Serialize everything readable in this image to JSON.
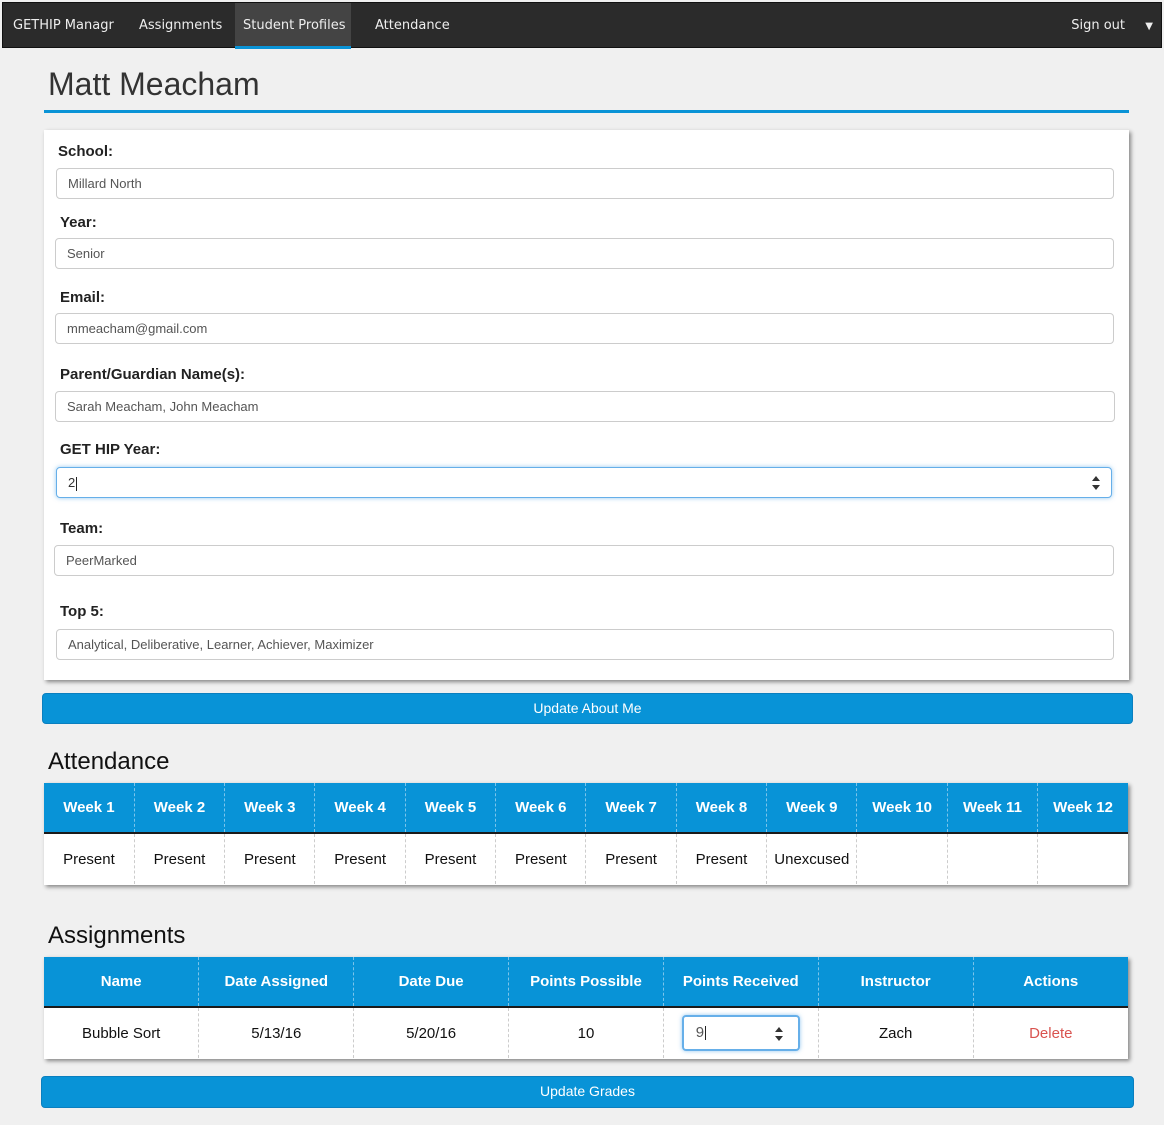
{
  "nav": {
    "brand": "GETHIP Managr",
    "items": [
      {
        "label": "Assignments"
      },
      {
        "label": "Student Profiles"
      },
      {
        "label": "Attendance"
      }
    ],
    "signout": "Sign out",
    "caret": "▼"
  },
  "profile": {
    "title": "Matt Meacham",
    "fields": [
      {
        "label": "School:",
        "value": "Millard North"
      },
      {
        "label": "Year:",
        "value": "Senior"
      },
      {
        "label": "Email:",
        "value": "mmeacham@gmail.com"
      },
      {
        "label": "Parent/Guardian Name(s):",
        "value": "Sarah Meacham, John Meacham"
      },
      {
        "label": "GET HIP Year:",
        "value": "2"
      },
      {
        "label": "Team:",
        "value": "PeerMarked"
      },
      {
        "label": "Top 5:",
        "value": "Analytical, Deliberative, Learner, Achiever, Maximizer"
      }
    ],
    "update_button": "Update About Me"
  },
  "attendance": {
    "title": "Attendance",
    "weeks": [
      "Week 1",
      "Week 2",
      "Week 3",
      "Week 4",
      "Week 5",
      "Week 6",
      "Week 7",
      "Week 8",
      "Week 9",
      "Week 10",
      "Week 11",
      "Week 12"
    ],
    "values": [
      "Present",
      "Present",
      "Present",
      "Present",
      "Present",
      "Present",
      "Present",
      "Present",
      "Unexcused",
      "",
      "",
      ""
    ]
  },
  "assignments": {
    "title": "Assignments",
    "columns": [
      "Name",
      "Date Assigned",
      "Date Due",
      "Points Possible",
      "Points Received",
      "Instructor",
      "Actions"
    ],
    "rows": [
      {
        "name": "Bubble Sort",
        "date_assigned": "5/13/16",
        "date_due": "5/20/16",
        "points_possible": "10",
        "points_received": "9",
        "instructor": "Zach",
        "action": "Delete"
      }
    ],
    "update_button": "Update Grades"
  },
  "colors": {
    "accent": "#0893d7",
    "navbar": "#2b2b2b",
    "delete": "#d9534f"
  }
}
